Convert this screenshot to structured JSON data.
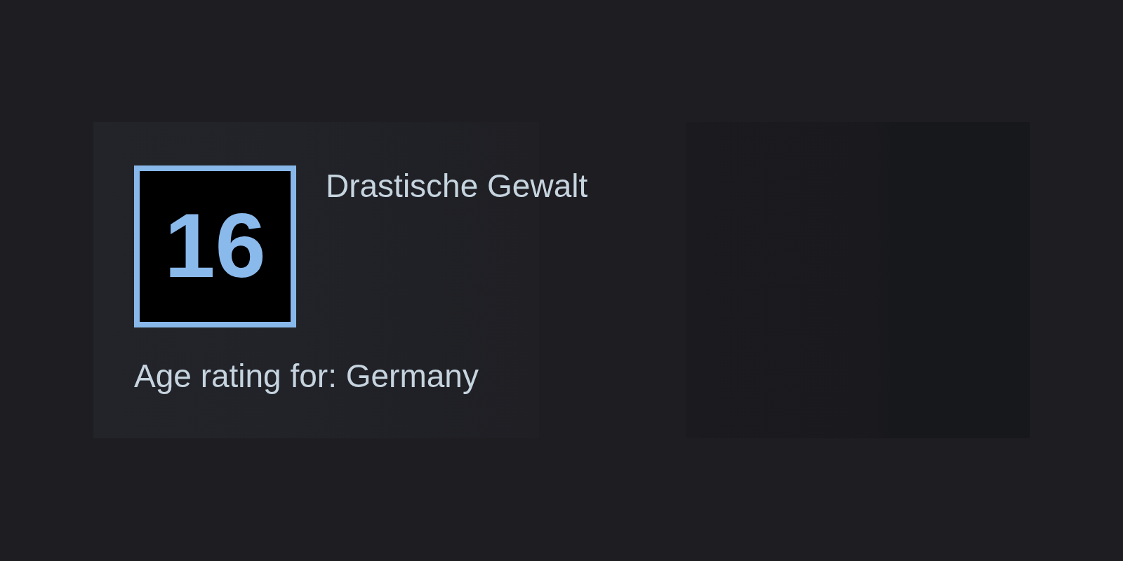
{
  "age_rating": {
    "badge": "16",
    "descriptor": "Drastische Gewalt",
    "region_label": "Age rating for: Germany"
  }
}
